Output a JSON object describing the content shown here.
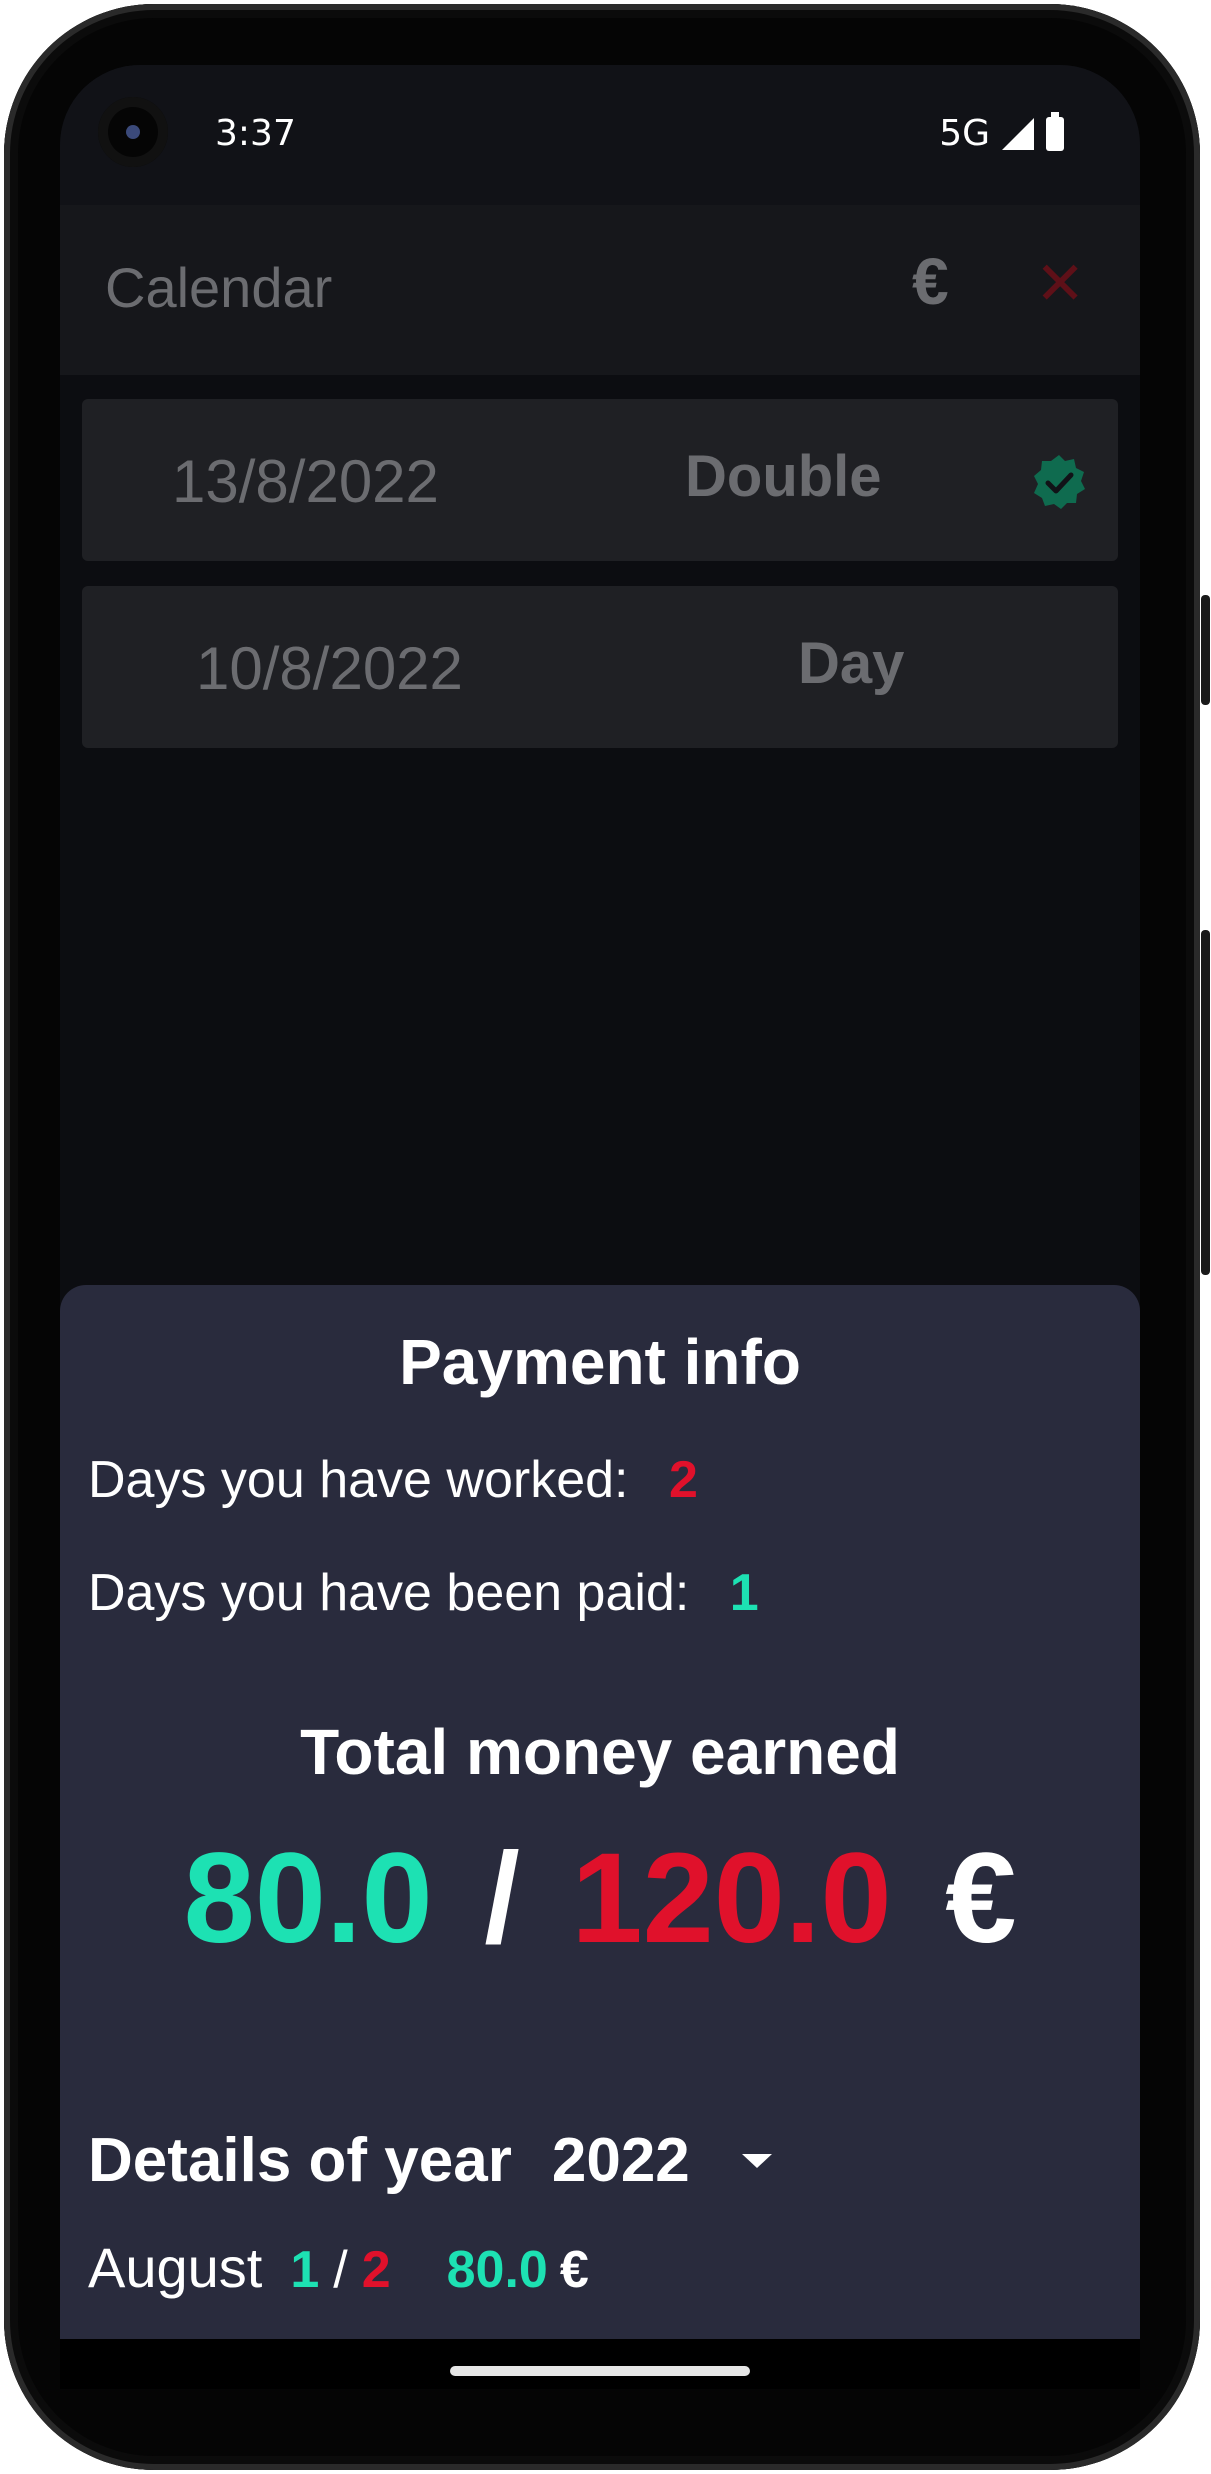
{
  "status_bar": {
    "time": "3:37",
    "network": "5G"
  },
  "app_bar": {
    "title": "Calendar",
    "currency_symbol": "€",
    "close_symbol": "✕"
  },
  "entries": [
    {
      "date": "13/8/2022",
      "type": "Double",
      "paid": true
    },
    {
      "date": "10/8/2022",
      "type": "Day",
      "paid": false
    }
  ],
  "payment_info": {
    "title": "Payment info",
    "days_worked_label": "Days you have worked:",
    "days_worked": "2",
    "days_paid_label": "Days you have been paid:",
    "days_paid": "1",
    "total_title": "Total money earned",
    "paid_amount": "80.0",
    "separator": "/",
    "total_amount": "120.0",
    "currency": "€",
    "details_label": "Details of year",
    "year": "2022",
    "months": [
      {
        "name": "August",
        "paid_days": "1",
        "slash": "/",
        "worked_days": "2",
        "amount": "80.0",
        "currency": "€"
      }
    ]
  },
  "colors": {
    "accent_green": "#1de1b3",
    "accent_red": "#e0112b",
    "sheet_bg": "#292b3d",
    "verified_green": "#0f6b4f"
  }
}
